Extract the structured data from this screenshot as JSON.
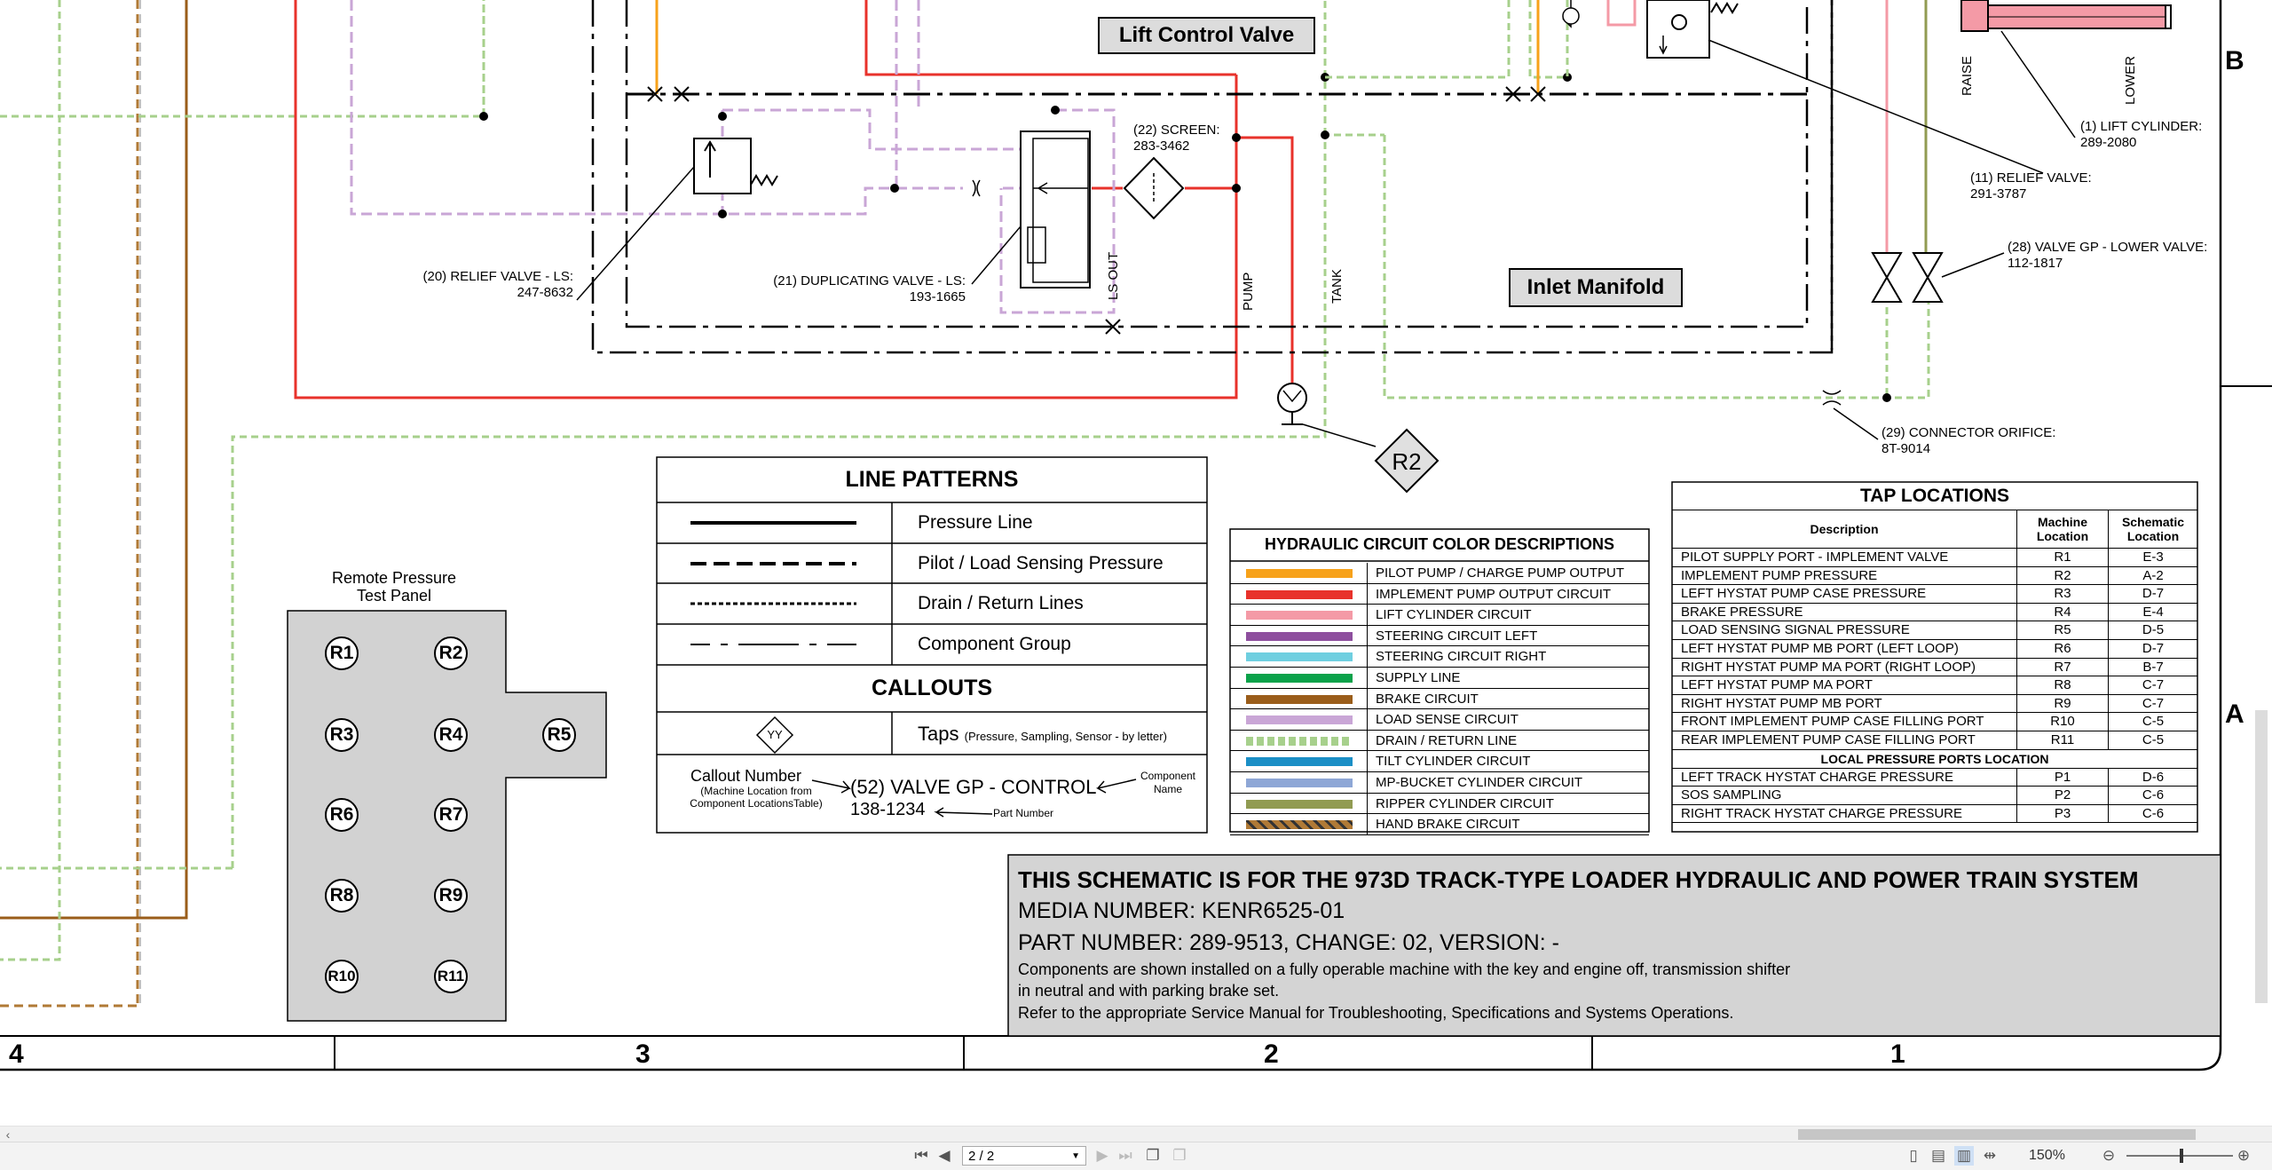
{
  "schematic": {
    "lift_control_valve": "Lift Control Valve",
    "inlet_manifold": "Inlet Manifold",
    "screen_label": [
      "(22) SCREEN:",
      "283-3462"
    ],
    "relief_ls_label": [
      "(20) RELIEF VALVE - LS:",
      "247-8632"
    ],
    "dup_valve_label": [
      "(21) DUPLICATING VALVE - LS:",
      "193-1665"
    ],
    "ls_out": "LS OUT",
    "pump": "PUMP",
    "tank": "TANK",
    "raise": "RAISE",
    "lower": "LOWER",
    "lift_cyl_label": [
      "(1) LIFT CYLINDER:",
      "289-2080"
    ],
    "relief_valve_label": [
      "(11) RELIEF VALVE:",
      "291-3787"
    ],
    "valve_lower_label": [
      "(28) VALVE GP - LOWER VALVE:",
      "112-1817"
    ],
    "orifice_label": [
      "(29) CONNECTOR ORIFICE:",
      "8T-9014"
    ],
    "r2_tap": "R2",
    "zone_b": "B",
    "zone_a": "A",
    "zones_bottom": [
      "4",
      "3",
      "2",
      "1"
    ]
  },
  "remote_panel": {
    "title": [
      "Remote Pressure",
      "Test Panel"
    ],
    "ports": [
      "R1",
      "R2",
      "R3",
      "R4",
      "R5",
      "R6",
      "R7",
      "R8",
      "R9",
      "R10",
      "R11"
    ]
  },
  "line_patterns": {
    "title": "LINE PATTERNS",
    "rows": [
      "Pressure Line",
      "Pilot / Load Sensing Pressure",
      "Drain / Return Lines",
      "Component Group"
    ],
    "callouts_title": "CALLOUTS",
    "taps_label": "Taps",
    "taps_note": "(Pressure, Sampling, Sensor - by letter)",
    "tap_symbol": "YY",
    "callout_number": "Callout Number",
    "callout_note": [
      "(Machine Location from",
      "Component LocationsTable)"
    ],
    "callout_example": "(52) VALVE GP - CONTROL",
    "callout_part": "138-1234",
    "component_name": [
      "Component",
      "Name"
    ],
    "part_number": "Part Number"
  },
  "color_desc": {
    "title": "HYDRAULIC CIRCUIT COLOR DESCRIPTIONS",
    "items": [
      {
        "color": "#f7a21b",
        "label": "PILOT PUMP / CHARGE PUMP OUTPUT"
      },
      {
        "color": "#e8322b",
        "label": "IMPLEMENT PUMP OUTPUT CIRCUIT"
      },
      {
        "color": "#f49aa6",
        "label": "LIFT CYLINDER CIRCUIT"
      },
      {
        "color": "#8e4f9e",
        "label": "STEERING CIRCUIT LEFT"
      },
      {
        "color": "#6fcfe0",
        "label": "STEERING CIRCUIT RIGHT"
      },
      {
        "color": "#0aa24a",
        "label": "SUPPLY LINE"
      },
      {
        "color": "#9a5d1a",
        "label": "BRAKE CIRCUIT"
      },
      {
        "color": "#c9a6d6",
        "label": "LOAD SENSE CIRCUIT"
      },
      {
        "color": "#a7d08c",
        "label": "DRAIN / RETURN LINE"
      },
      {
        "color": "#1b8fc6",
        "label": "TILT CYLINDER CIRCUIT"
      },
      {
        "color": "#8ea7d6",
        "label": "MP-BUCKET CYLINDER CIRCUIT"
      },
      {
        "color": "#919b52",
        "label": "RIPPER CYLINDER CIRCUIT"
      },
      {
        "color": "#b07a36",
        "label": "HAND BRAKE CIRCUIT"
      }
    ]
  },
  "tap_locations": {
    "title": "TAP LOCATIONS",
    "headers": [
      "Description",
      "Machine Location",
      "Schematic Location"
    ],
    "rows": [
      [
        "PILOT SUPPLY PORT - IMPLEMENT VALVE",
        "R1",
        "E-3"
      ],
      [
        "IMPLEMENT PUMP PRESSURE",
        "R2",
        "A-2"
      ],
      [
        "LEFT HYSTAT PUMP CASE PRESSURE",
        "R3",
        "D-7"
      ],
      [
        "BRAKE PRESSURE",
        "R4",
        "E-4"
      ],
      [
        "LOAD SENSING SIGNAL PRESSURE",
        "R5",
        "D-5"
      ],
      [
        "LEFT HYSTAT PUMP MB PORT (LEFT LOOP)",
        "R6",
        "D-7"
      ],
      [
        "RIGHT HYSTAT PUMP MA PORT (RIGHT LOOP)",
        "R7",
        "B-7"
      ],
      [
        "LEFT HYSTAT PUMP MA PORT",
        "R8",
        "C-7"
      ],
      [
        "RIGHT HYSTAT PUMP MB PORT",
        "R9",
        "C-7"
      ],
      [
        "FRONT IMPLEMENT PUMP CASE FILLING PORT",
        "R10",
        "C-5"
      ],
      [
        "REAR IMPLEMENT PUMP CASE FILLING PORT",
        "R11",
        "C-5"
      ]
    ],
    "local_title": "LOCAL PRESSURE PORTS LOCATION",
    "local_rows": [
      [
        "LEFT TRACK HYSTAT CHARGE PRESSURE",
        "P1",
        "D-6"
      ],
      [
        "SOS SAMPLING",
        "P2",
        "C-6"
      ],
      [
        "RIGHT TRACK HYSTAT CHARGE PRESSURE",
        "P3",
        "C-6"
      ]
    ]
  },
  "title_block": {
    "line1": "THIS SCHEMATIC IS FOR THE 973D TRACK-TYPE LOADER HYDRAULIC AND POWER TRAIN SYSTEM",
    "line2": "MEDIA NUMBER: KENR6525-01",
    "line3": "PART NUMBER: 289-9513, CHANGE: 02, VERSION: -",
    "line4": "Components are shown installed on a fully operable machine with the key and engine off, transmission shifter",
    "line5": "in neutral and with parking brake set.",
    "line6": "Refer to the appropriate Service Manual for Troubleshooting, Specifications and Systems Operations."
  },
  "viewer": {
    "page_value": "2 / 2",
    "zoom": "150%"
  }
}
